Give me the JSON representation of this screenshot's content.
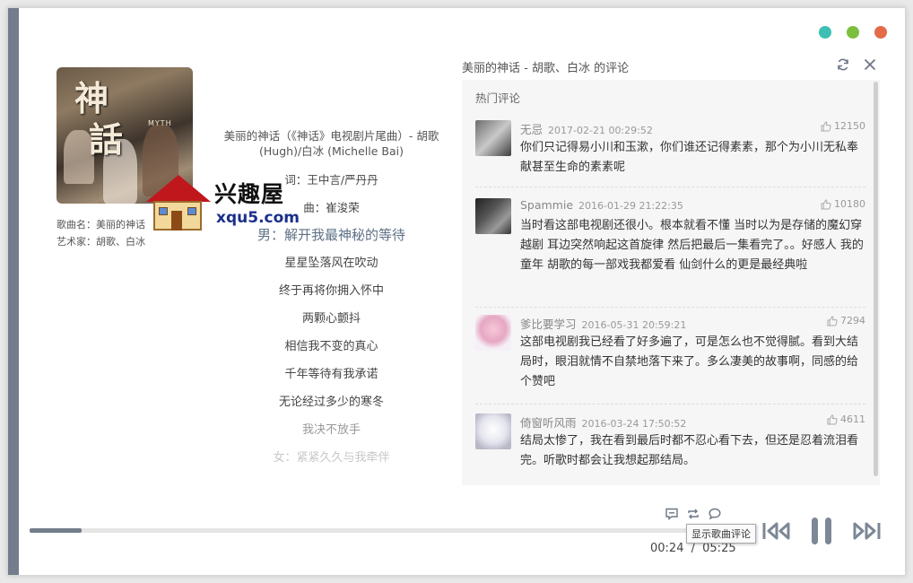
{
  "window": {
    "controls": {
      "minimize_color": "#3ebfb3",
      "maximize_color": "#7cbf3e",
      "close_color": "#e36b4a"
    }
  },
  "song": {
    "cover_chars": [
      "神",
      "話"
    ],
    "cover_small": "MYTH",
    "name_label": "歌曲名：",
    "name": "美丽的神话",
    "artist_label": "艺术家：",
    "artist": "胡歌、白冰"
  },
  "watermark": {
    "text": "兴趣屋",
    "url": "xqu5.com"
  },
  "lyrics": {
    "header": "美丽的神话（《神话》电视剧片尾曲）- 胡歌(Hugh)/白冰 (Michelle Bai)",
    "lines": [
      "词：王中言/严丹丹",
      "曲：崔浚荣",
      "男：解开我最神秘的等待",
      "星星坠落风在吹动",
      "终于再将你拥入怀中",
      "两颗心颤抖",
      "相信我不变的真心",
      "千年等待有我承诺",
      "无论经过多少的寒冬",
      "我决不放手",
      "女：紧紧久久与我牵伴"
    ],
    "current_index": 2
  },
  "comments": {
    "title": "美丽的神话 - 胡歌、白冰 的评论",
    "section_label": "热门评论",
    "items": [
      {
        "user": "无忌",
        "date": "2017-02-21 00:29:52",
        "likes": "12150",
        "text": "你们只记得易小川和玉漱，你们谁还记得素素，那个为小川无私奉献甚至生命的素素呢"
      },
      {
        "user": "Spammie",
        "date": "2016-01-29 21:22:35",
        "likes": "10180",
        "text": "当时看这部电视剧还很小。根本就看不懂 当时以为是存储的魔幻穿越剧 耳边突然响起这首旋律 然后把最后一集看完了。。好感人 我的童年 胡歌的每一部戏我都爱看 仙剑什么的更是最经典啦"
      },
      {
        "user": "爹比要学习",
        "date": "2016-05-31 20:59:21",
        "likes": "7294",
        "text": "这部电视剧我已经看了好多遍了，可是怎么也不觉得腻。看到大结局时，眼泪就情不自禁地落下来了。多么凄美的故事啊，同感的给个赞吧"
      },
      {
        "user": "倚窗听风雨",
        "date": "2016-03-24 17:50:52",
        "likes": "4611",
        "text": "结局太惨了，我在看到最后时都不忍心看下去，但还是忍着流泪看完。听歌时都会让我想起那结局。"
      }
    ]
  },
  "player": {
    "progress": 0.0715,
    "current_time": "00:24",
    "separator": "/",
    "total_time": "05:25",
    "tooltip": "显示歌曲评论",
    "accent": "#737d8c"
  }
}
